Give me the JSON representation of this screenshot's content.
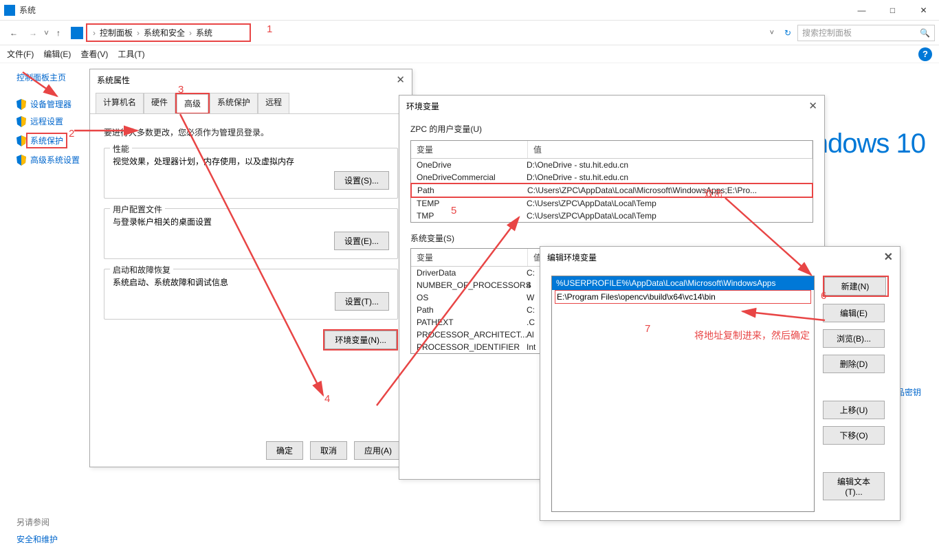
{
  "window": {
    "title": "系统",
    "controls": {
      "min": "—",
      "max": "□",
      "close": "✕"
    }
  },
  "nav": {
    "breadcrumbs": [
      "控制面板",
      "系统和安全",
      "系统"
    ],
    "search_placeholder": "搜索控制面板"
  },
  "menu": {
    "file": "文件(F)",
    "edit": "编辑(E)",
    "view": "查看(V)",
    "tools": "工具(T)"
  },
  "sidebar": {
    "home": "控制面板主页",
    "links": [
      "设备管理器",
      "远程设置",
      "系统保护",
      "高级系统设置"
    ],
    "see_also": "另请参阅",
    "security": "安全和维护"
  },
  "brand": {
    "logo_text": "ndows 10"
  },
  "product_key_link": "品密钥",
  "dlg1": {
    "title": "系统属性",
    "tabs": [
      "计算机名",
      "硬件",
      "高级",
      "系统保护",
      "远程"
    ],
    "admin_text": "要进行大多数更改，您必须作为管理员登录。",
    "perf_legend": "性能",
    "perf_text": "视觉效果，处理器计划，内存使用，以及虚拟内存",
    "btn_set_s": "设置(S)...",
    "profile_legend": "用户配置文件",
    "profile_text": "与登录帐户相关的桌面设置",
    "btn_set_e": "设置(E)...",
    "startup_legend": "启动和故障恢复",
    "startup_text": "系统启动、系统故障和调试信息",
    "btn_set_t": "设置(T)...",
    "btn_env": "环境变量(N)...",
    "btn_ok": "确定",
    "btn_cancel": "取消",
    "btn_apply": "应用(A)"
  },
  "dlg2": {
    "title": "环境变量",
    "user_label": "ZPC 的用户变量(U)",
    "hdr_var": "变量",
    "hdr_val": "值",
    "user_rows": [
      {
        "var": "OneDrive",
        "val": "D:\\OneDrive - stu.hit.edu.cn"
      },
      {
        "var": "OneDriveCommercial",
        "val": "D:\\OneDrive - stu.hit.edu.cn"
      },
      {
        "var": "Path",
        "val": "C:\\Users\\ZPC\\AppData\\Local\\Microsoft\\WindowsApps;E:\\Pro..."
      },
      {
        "var": "TEMP",
        "val": "C:\\Users\\ZPC\\AppData\\Local\\Temp"
      },
      {
        "var": "TMP",
        "val": "C:\\Users\\ZPC\\AppData\\Local\\Temp"
      }
    ],
    "sys_label": "系统变量(S)",
    "sys_rows": [
      {
        "var": "DriverData",
        "val": "C:"
      },
      {
        "var": "NUMBER_OF_PROCESSORS",
        "val": "4"
      },
      {
        "var": "OS",
        "val": "W"
      },
      {
        "var": "Path",
        "val": "C:"
      },
      {
        "var": "PATHEXT",
        "val": ".C"
      },
      {
        "var": "PROCESSOR_ARCHITECT...",
        "val": "Al"
      },
      {
        "var": "PROCESSOR_IDENTIFIER",
        "val": "Int"
      }
    ]
  },
  "dlg3": {
    "title": "编辑环境变量",
    "paths": [
      "%USERPROFILE%\\AppData\\Local\\Microsoft\\WindowsApps",
      "E:\\Program Files\\opencv\\build\\x64\\vc14\\bin"
    ],
    "btn_new": "新建(N)",
    "btn_edit": "编辑(E)",
    "btn_browse": "浏览(B)...",
    "btn_delete": "删除(D)",
    "btn_up": "上移(U)",
    "btn_down": "下移(O)",
    "btn_text": "编辑文本(T)..."
  },
  "anno": {
    "n1": "1",
    "n2": "2",
    "n3": "3",
    "n4": "4",
    "n5": "5",
    "n6": "6",
    "n7": "7",
    "dbl": "双击",
    "copy": "将地址复制进来，然后确定"
  }
}
